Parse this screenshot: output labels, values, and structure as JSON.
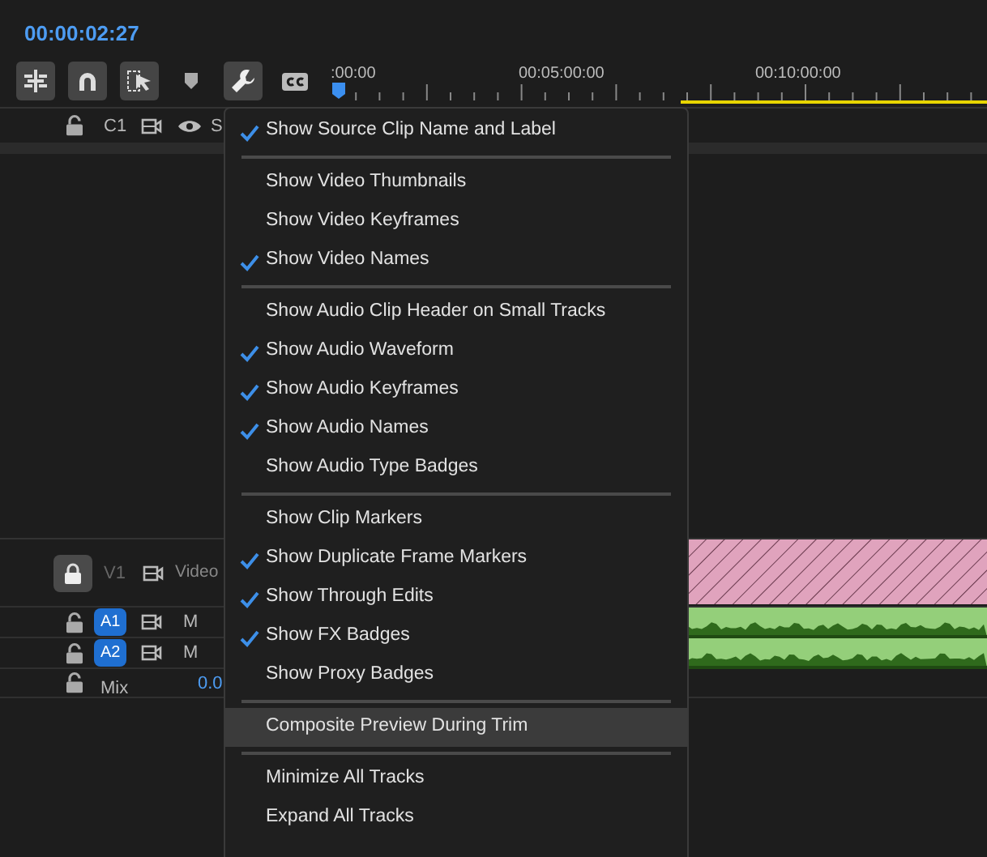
{
  "timecode": "00:00:02:27",
  "toolbar": [
    {
      "kind": "insert",
      "on": true
    },
    {
      "kind": "snap",
      "on": true
    },
    {
      "kind": "linked",
      "on": true
    },
    {
      "kind": "marker",
      "on": false
    },
    {
      "kind": "wrench",
      "on": true
    },
    {
      "kind": "captions",
      "on": false
    }
  ],
  "ruler": {
    "labels": [
      ":00:00",
      "00:05:00:00",
      "00:10:00:00"
    ]
  },
  "tracks": [
    {
      "kind": "caption",
      "label": "C1",
      "name": "S",
      "locked": false
    },
    {
      "kind": "video",
      "label": "V1",
      "name": "Video",
      "locked": true
    },
    {
      "kind": "audio",
      "label": "A1",
      "mute": "M",
      "locked": false,
      "targeted": true
    },
    {
      "kind": "audio",
      "label": "A2",
      "mute": "M",
      "locked": false,
      "targeted": true
    },
    {
      "kind": "mix",
      "name": "Mix",
      "value": "0.0",
      "locked": false
    }
  ],
  "menu": {
    "groups": [
      [
        {
          "label": "Show Source Clip Name and Label",
          "checked": true,
          "highlighted": false
        }
      ],
      [
        {
          "label": "Show Video Thumbnails",
          "checked": false,
          "highlighted": false
        },
        {
          "label": "Show Video Keyframes",
          "checked": false,
          "highlighted": false
        },
        {
          "label": "Show Video Names",
          "checked": true,
          "highlighted": false
        }
      ],
      [
        {
          "label": "Show Audio Clip Header on Small Tracks",
          "checked": false,
          "highlighted": false
        },
        {
          "label": "Show Audio Waveform",
          "checked": true,
          "highlighted": false
        },
        {
          "label": "Show Audio Keyframes",
          "checked": true,
          "highlighted": false
        },
        {
          "label": "Show Audio Names",
          "checked": true,
          "highlighted": false
        },
        {
          "label": "Show Audio Type Badges",
          "checked": false,
          "highlighted": false
        }
      ],
      [
        {
          "label": "Show Clip Markers",
          "checked": false,
          "highlighted": false
        },
        {
          "label": "Show Duplicate Frame Markers",
          "checked": true,
          "highlighted": false
        },
        {
          "label": "Show Through Edits",
          "checked": true,
          "highlighted": false
        },
        {
          "label": "Show FX Badges",
          "checked": true,
          "highlighted": false
        },
        {
          "label": "Show Proxy Badges",
          "checked": false,
          "highlighted": false
        }
      ],
      [
        {
          "label": "Composite Preview During Trim",
          "checked": false,
          "highlighted": true
        }
      ],
      [
        {
          "label": "Minimize All Tracks",
          "checked": false,
          "highlighted": false
        },
        {
          "label": "Expand All Tracks",
          "checked": false,
          "highlighted": false
        }
      ]
    ]
  }
}
